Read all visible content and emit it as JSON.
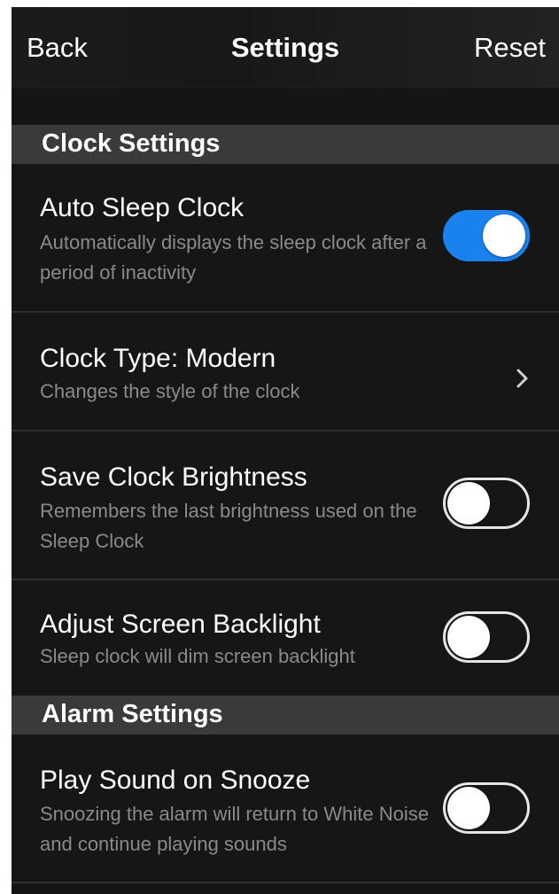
{
  "navbar": {
    "back_label": "Back",
    "title": "Settings",
    "reset_label": "Reset"
  },
  "sections": [
    {
      "header": "Clock Settings",
      "rows": [
        {
          "title": "Auto Sleep Clock",
          "description": "Automatically displays the sleep clock after a period of inactivity",
          "control": "toggle",
          "enabled": true
        },
        {
          "title": "Clock Type: Modern",
          "description": "Changes the style of the clock",
          "control": "chevron-right-icon"
        },
        {
          "title": "Save Clock Brightness",
          "description": "Remembers the last brightness used on the Sleep Clock",
          "control": "toggle",
          "enabled": false
        },
        {
          "title": "Adjust Screen Backlight",
          "description": "Sleep clock will dim screen backlight",
          "control": "toggle",
          "enabled": false
        }
      ]
    },
    {
      "header": "Alarm Settings",
      "rows": [
        {
          "title": "Play Sound on Snooze",
          "description": "Snoozing the alarm will return to White Noise and continue playing sounds",
          "control": "toggle",
          "enabled": false
        }
      ]
    }
  ],
  "colors": {
    "toggle_on": "#1a82f0",
    "background": "#151515",
    "section_header": "#3a3a3a",
    "description_text": "#8a8a8a"
  }
}
